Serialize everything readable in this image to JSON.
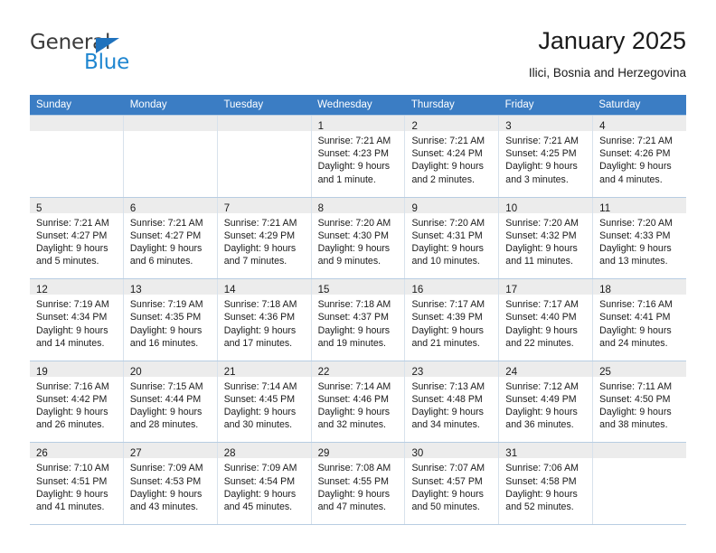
{
  "brand": {
    "name_top": "General",
    "name_bottom": "Blue",
    "triangle_icon": "triangle-icon",
    "color_top": "#3b3b3b",
    "color_bottom": "#1f86d0"
  },
  "header": {
    "title": "January 2025",
    "subtitle": "Ilici, Bosnia and Herzegovina"
  },
  "theme": {
    "header_bar": "#3b7dc4",
    "daynum_bar": "#ececec",
    "grid_line": "#b8cde2",
    "text": "#1a1a1a"
  },
  "weekdays": [
    "Sunday",
    "Monday",
    "Tuesday",
    "Wednesday",
    "Thursday",
    "Friday",
    "Saturday"
  ],
  "weeks": [
    [
      {
        "day": "",
        "lines": []
      },
      {
        "day": "",
        "lines": []
      },
      {
        "day": "",
        "lines": []
      },
      {
        "day": "1",
        "lines": [
          "Sunrise: 7:21 AM",
          "Sunset: 4:23 PM",
          "Daylight: 9 hours",
          "and 1 minute."
        ]
      },
      {
        "day": "2",
        "lines": [
          "Sunrise: 7:21 AM",
          "Sunset: 4:24 PM",
          "Daylight: 9 hours",
          "and 2 minutes."
        ]
      },
      {
        "day": "3",
        "lines": [
          "Sunrise: 7:21 AM",
          "Sunset: 4:25 PM",
          "Daylight: 9 hours",
          "and 3 minutes."
        ]
      },
      {
        "day": "4",
        "lines": [
          "Sunrise: 7:21 AM",
          "Sunset: 4:26 PM",
          "Daylight: 9 hours",
          "and 4 minutes."
        ]
      }
    ],
    [
      {
        "day": "5",
        "lines": [
          "Sunrise: 7:21 AM",
          "Sunset: 4:27 PM",
          "Daylight: 9 hours",
          "and 5 minutes."
        ]
      },
      {
        "day": "6",
        "lines": [
          "Sunrise: 7:21 AM",
          "Sunset: 4:27 PM",
          "Daylight: 9 hours",
          "and 6 minutes."
        ]
      },
      {
        "day": "7",
        "lines": [
          "Sunrise: 7:21 AM",
          "Sunset: 4:29 PM",
          "Daylight: 9 hours",
          "and 7 minutes."
        ]
      },
      {
        "day": "8",
        "lines": [
          "Sunrise: 7:20 AM",
          "Sunset: 4:30 PM",
          "Daylight: 9 hours",
          "and 9 minutes."
        ]
      },
      {
        "day": "9",
        "lines": [
          "Sunrise: 7:20 AM",
          "Sunset: 4:31 PM",
          "Daylight: 9 hours",
          "and 10 minutes."
        ]
      },
      {
        "day": "10",
        "lines": [
          "Sunrise: 7:20 AM",
          "Sunset: 4:32 PM",
          "Daylight: 9 hours",
          "and 11 minutes."
        ]
      },
      {
        "day": "11",
        "lines": [
          "Sunrise: 7:20 AM",
          "Sunset: 4:33 PM",
          "Daylight: 9 hours",
          "and 13 minutes."
        ]
      }
    ],
    [
      {
        "day": "12",
        "lines": [
          "Sunrise: 7:19 AM",
          "Sunset: 4:34 PM",
          "Daylight: 9 hours",
          "and 14 minutes."
        ]
      },
      {
        "day": "13",
        "lines": [
          "Sunrise: 7:19 AM",
          "Sunset: 4:35 PM",
          "Daylight: 9 hours",
          "and 16 minutes."
        ]
      },
      {
        "day": "14",
        "lines": [
          "Sunrise: 7:18 AM",
          "Sunset: 4:36 PM",
          "Daylight: 9 hours",
          "and 17 minutes."
        ]
      },
      {
        "day": "15",
        "lines": [
          "Sunrise: 7:18 AM",
          "Sunset: 4:37 PM",
          "Daylight: 9 hours",
          "and 19 minutes."
        ]
      },
      {
        "day": "16",
        "lines": [
          "Sunrise: 7:17 AM",
          "Sunset: 4:39 PM",
          "Daylight: 9 hours",
          "and 21 minutes."
        ]
      },
      {
        "day": "17",
        "lines": [
          "Sunrise: 7:17 AM",
          "Sunset: 4:40 PM",
          "Daylight: 9 hours",
          "and 22 minutes."
        ]
      },
      {
        "day": "18",
        "lines": [
          "Sunrise: 7:16 AM",
          "Sunset: 4:41 PM",
          "Daylight: 9 hours",
          "and 24 minutes."
        ]
      }
    ],
    [
      {
        "day": "19",
        "lines": [
          "Sunrise: 7:16 AM",
          "Sunset: 4:42 PM",
          "Daylight: 9 hours",
          "and 26 minutes."
        ]
      },
      {
        "day": "20",
        "lines": [
          "Sunrise: 7:15 AM",
          "Sunset: 4:44 PM",
          "Daylight: 9 hours",
          "and 28 minutes."
        ]
      },
      {
        "day": "21",
        "lines": [
          "Sunrise: 7:14 AM",
          "Sunset: 4:45 PM",
          "Daylight: 9 hours",
          "and 30 minutes."
        ]
      },
      {
        "day": "22",
        "lines": [
          "Sunrise: 7:14 AM",
          "Sunset: 4:46 PM",
          "Daylight: 9 hours",
          "and 32 minutes."
        ]
      },
      {
        "day": "23",
        "lines": [
          "Sunrise: 7:13 AM",
          "Sunset: 4:48 PM",
          "Daylight: 9 hours",
          "and 34 minutes."
        ]
      },
      {
        "day": "24",
        "lines": [
          "Sunrise: 7:12 AM",
          "Sunset: 4:49 PM",
          "Daylight: 9 hours",
          "and 36 minutes."
        ]
      },
      {
        "day": "25",
        "lines": [
          "Sunrise: 7:11 AM",
          "Sunset: 4:50 PM",
          "Daylight: 9 hours",
          "and 38 minutes."
        ]
      }
    ],
    [
      {
        "day": "26",
        "lines": [
          "Sunrise: 7:10 AM",
          "Sunset: 4:51 PM",
          "Daylight: 9 hours",
          "and 41 minutes."
        ]
      },
      {
        "day": "27",
        "lines": [
          "Sunrise: 7:09 AM",
          "Sunset: 4:53 PM",
          "Daylight: 9 hours",
          "and 43 minutes."
        ]
      },
      {
        "day": "28",
        "lines": [
          "Sunrise: 7:09 AM",
          "Sunset: 4:54 PM",
          "Daylight: 9 hours",
          "and 45 minutes."
        ]
      },
      {
        "day": "29",
        "lines": [
          "Sunrise: 7:08 AM",
          "Sunset: 4:55 PM",
          "Daylight: 9 hours",
          "and 47 minutes."
        ]
      },
      {
        "day": "30",
        "lines": [
          "Sunrise: 7:07 AM",
          "Sunset: 4:57 PM",
          "Daylight: 9 hours",
          "and 50 minutes."
        ]
      },
      {
        "day": "31",
        "lines": [
          "Sunrise: 7:06 AM",
          "Sunset: 4:58 PM",
          "Daylight: 9 hours",
          "and 52 minutes."
        ]
      },
      {
        "day": "",
        "lines": []
      }
    ]
  ]
}
